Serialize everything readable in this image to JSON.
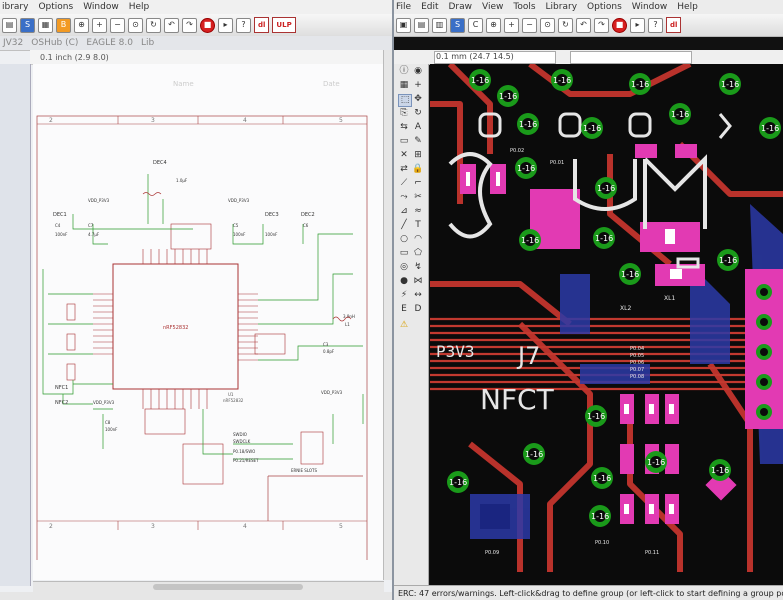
{
  "left": {
    "menu": [
      "ibrary",
      "Options",
      "Window",
      "Help"
    ],
    "breadcrumb": [
      "JV32",
      "OSHub (C)",
      "EAGLE 8.0",
      "Lib"
    ],
    "coord": "0.1 inch (2.9 8.0)",
    "col_numbers": [
      "2",
      "3",
      "4",
      "5"
    ],
    "chip_label": "nRF52832",
    "chip_ref": "U1",
    "chip_name_below": "nRF52832",
    "dec_labels": [
      "DEC1",
      "DEC3",
      "DEC2",
      "DEC4"
    ],
    "vdd_label": "VDD_P3V3",
    "sheet_headers": [
      "Name",
      "Date"
    ],
    "cap_labels": [
      "C4",
      "C7",
      "C5",
      "C6",
      "C3",
      "C8",
      "C9"
    ],
    "cap_values": [
      "100nF",
      "4.7µF",
      "100nF",
      "100nF",
      "1.0µF",
      "0.8pF",
      "100nF"
    ],
    "ind_label": "L1",
    "ind_value": "3.9nH",
    "nfc_labels": [
      "NFC1",
      "NFC2"
    ],
    "swd_labels": [
      "SWDIO",
      "SWDCLK",
      "P0.18/SWO",
      "P0.21/RESET"
    ],
    "conn_label": "ERNIE SLOTS"
  },
  "right": {
    "menu": [
      "File",
      "Edit",
      "Draw",
      "View",
      "Tools",
      "Library",
      "Options",
      "Window",
      "Help"
    ],
    "coord": "0.1 mm (24.7 14.5)",
    "silk_text": [
      "P3V3",
      "J7",
      "NFCT"
    ],
    "pad_label": "1-16",
    "nets": [
      "P0.04",
      "P0.05",
      "P0.06",
      "P0.07",
      "P0.08",
      "P0.09",
      "P0.10",
      "P0.11",
      "P0.02",
      "P0.01"
    ],
    "part_labels": [
      "XL1",
      "XL2"
    ],
    "status": "ERC: 47 errors/warnings. Left-click&drag to define group (or left-click to start defining a group polygon)"
  },
  "colors": {
    "board": "#0b0b0b",
    "copper_top": "#c0392b",
    "copper_bottom": "#2b3aa8",
    "pad": "#e23ab3",
    "via": "#3aa83a",
    "silk": "#e6e6e6"
  }
}
